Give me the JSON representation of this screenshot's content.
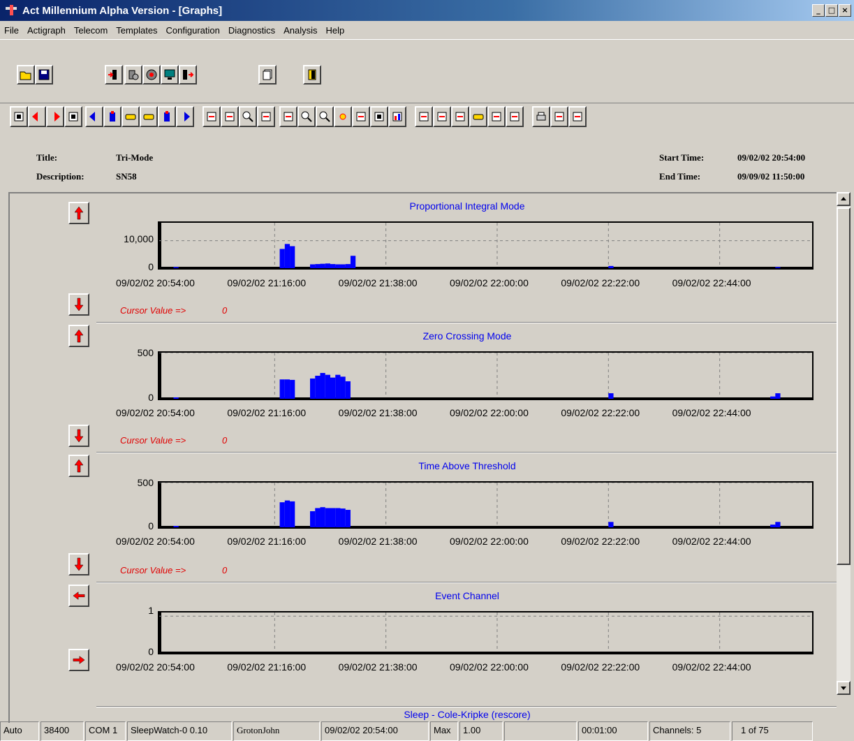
{
  "window": {
    "title": "Act Millennium Alpha Version - [Graphs]",
    "buttons": [
      "_",
      "□",
      "×"
    ]
  },
  "menu": [
    "File",
    "Actigraph",
    "Telecom",
    "Templates",
    "Configuration",
    "Diagnostics",
    "Analysis",
    "Help"
  ],
  "main_toolbar_icons": [
    "open-folder-icon",
    "save-disk-icon",
    "device-download-icon",
    "device-settings-icon",
    "record-icon",
    "monitor-icon",
    "device-upload-icon",
    "copy-pages-icon",
    "exit-door-icon"
  ],
  "nav_toolbar_icons": [
    "first-page-icon",
    "previous-arrow-icon",
    "next-arrow-icon",
    "last-page-icon",
    "scroll-left-icon",
    "zoom-out-time-icon",
    "hand-left-icon",
    "hand-right-icon",
    "zoom-in-time-icon",
    "scroll-right-icon",
    "add-marker-icon",
    "edit-icon",
    "magnify-icon",
    "remove-marker-icon",
    "pen-icon",
    "zoom-in-icon",
    "zoom-out-icon",
    "light-icon",
    "color-icon",
    "new-page-icon",
    "histogram-icon",
    "export-icon",
    "import-icon",
    "forward-icon",
    "hand-point-icon",
    "binoculars-icon",
    "stamp-icon",
    "print-icon",
    "tools-icon",
    "report-icon"
  ],
  "info": {
    "title_label": "Title:",
    "title_value": "Tri-Mode",
    "description_label": "Description:",
    "description_value": "SN58",
    "start_label": "Start Time:",
    "start_value": "09/02/02 20:54:00",
    "end_label": "End Time:",
    "end_value": "09/09/02 11:50:00"
  },
  "cursor_label": "Cursor Value =>",
  "cursor_values": [
    "0",
    "0",
    "0"
  ],
  "next_graph_title": "Sleep - Cole-Kripke (rescore)",
  "colors": {
    "bar": "#0000ff",
    "title": "#0000ee",
    "cursor": "#e00000",
    "arrow": "#ff0000"
  },
  "chart_data": [
    {
      "type": "bar",
      "title": "Proportional Integral Mode",
      "x_ticks": [
        "09/02/02 20:54:00",
        "09/02/02 21:16:00",
        "09/02/02 21:38:00",
        "09/02/02 22:00:00",
        "09/02/02 22:22:00",
        "09/02/02 22:44:00"
      ],
      "y_ticks": [
        "10,000",
        "0"
      ],
      "y_tick_values": [
        10000,
        0
      ],
      "ylim": [
        0,
        16500
      ],
      "x_minutes_from_start_range": [
        0,
        128
      ],
      "bars": [
        {
          "x": 2,
          "y": 400
        },
        {
          "x": 23,
          "y": 7000
        },
        {
          "x": 24,
          "y": 8800
        },
        {
          "x": 25,
          "y": 8000
        },
        {
          "x": 29,
          "y": 1400
        },
        {
          "x": 30,
          "y": 1500
        },
        {
          "x": 31,
          "y": 1600
        },
        {
          "x": 32,
          "y": 1700
        },
        {
          "x": 33,
          "y": 1500
        },
        {
          "x": 34,
          "y": 1400
        },
        {
          "x": 35,
          "y": 1400
        },
        {
          "x": 36,
          "y": 1500
        },
        {
          "x": 37,
          "y": 4500
        },
        {
          "x": 88,
          "y": 800
        },
        {
          "x": 121,
          "y": 400
        }
      ],
      "grid": true
    },
    {
      "type": "bar",
      "title": "Zero Crossing Mode",
      "x_ticks": [
        "09/02/02 20:54:00",
        "09/02/02 21:16:00",
        "09/02/02 21:38:00",
        "09/02/02 22:00:00",
        "09/02/02 22:22:00",
        "09/02/02 22:44:00"
      ],
      "y_ticks": [
        "500",
        "0"
      ],
      "y_tick_values": [
        500,
        0
      ],
      "ylim": [
        0,
        500
      ],
      "x_minutes_from_start_range": [
        0,
        128
      ],
      "bars": [
        {
          "x": 2,
          "y": 15
        },
        {
          "x": 23,
          "y": 210
        },
        {
          "x": 24,
          "y": 210
        },
        {
          "x": 25,
          "y": 205
        },
        {
          "x": 29,
          "y": 220
        },
        {
          "x": 30,
          "y": 250
        },
        {
          "x": 31,
          "y": 280
        },
        {
          "x": 32,
          "y": 260
        },
        {
          "x": 33,
          "y": 230
        },
        {
          "x": 34,
          "y": 260
        },
        {
          "x": 35,
          "y": 240
        },
        {
          "x": 36,
          "y": 190
        },
        {
          "x": 88,
          "y": 60
        },
        {
          "x": 120,
          "y": 25
        },
        {
          "x": 121,
          "y": 60
        }
      ],
      "grid": true
    },
    {
      "type": "bar",
      "title": "Time Above Threshold",
      "x_ticks": [
        "09/02/02 20:54:00",
        "09/02/02 21:16:00",
        "09/02/02 21:38:00",
        "09/02/02 22:00:00",
        "09/02/02 22:22:00",
        "09/02/02 22:44:00"
      ],
      "y_ticks": [
        "500",
        "0"
      ],
      "y_tick_values": [
        500,
        0
      ],
      "ylim": [
        0,
        500
      ],
      "x_minutes_from_start_range": [
        0,
        128
      ],
      "bars": [
        {
          "x": 2,
          "y": 15
        },
        {
          "x": 23,
          "y": 280
        },
        {
          "x": 24,
          "y": 300
        },
        {
          "x": 25,
          "y": 290
        },
        {
          "x": 29,
          "y": 180
        },
        {
          "x": 30,
          "y": 215
        },
        {
          "x": 31,
          "y": 225
        },
        {
          "x": 32,
          "y": 215
        },
        {
          "x": 33,
          "y": 215
        },
        {
          "x": 34,
          "y": 215
        },
        {
          "x": 35,
          "y": 210
        },
        {
          "x": 36,
          "y": 195
        },
        {
          "x": 88,
          "y": 60
        },
        {
          "x": 120,
          "y": 30
        },
        {
          "x": 121,
          "y": 60
        }
      ],
      "grid": true
    },
    {
      "type": "bar",
      "title": "Event Channel",
      "x_ticks": [
        "09/02/02 20:54:00",
        "09/02/02 21:16:00",
        "09/02/02 21:38:00",
        "09/02/02 22:00:00",
        "09/02/02 22:22:00",
        "09/02/02 22:44:00"
      ],
      "y_ticks": [
        "1",
        "0"
      ],
      "y_tick_values": [
        1,
        0
      ],
      "ylim": [
        0,
        1.1
      ],
      "x_minutes_from_start_range": [
        0,
        128
      ],
      "bars": [],
      "grid": true
    }
  ],
  "status": [
    "Auto",
    "38400",
    "COM 1",
    "SleepWatch-0 0.10",
    "GrotonJohn",
    "09/02/02 20:54:00",
    "Max",
    "1.00",
    "",
    "00:01:00",
    "Channels: 5",
    "1 of 75"
  ]
}
